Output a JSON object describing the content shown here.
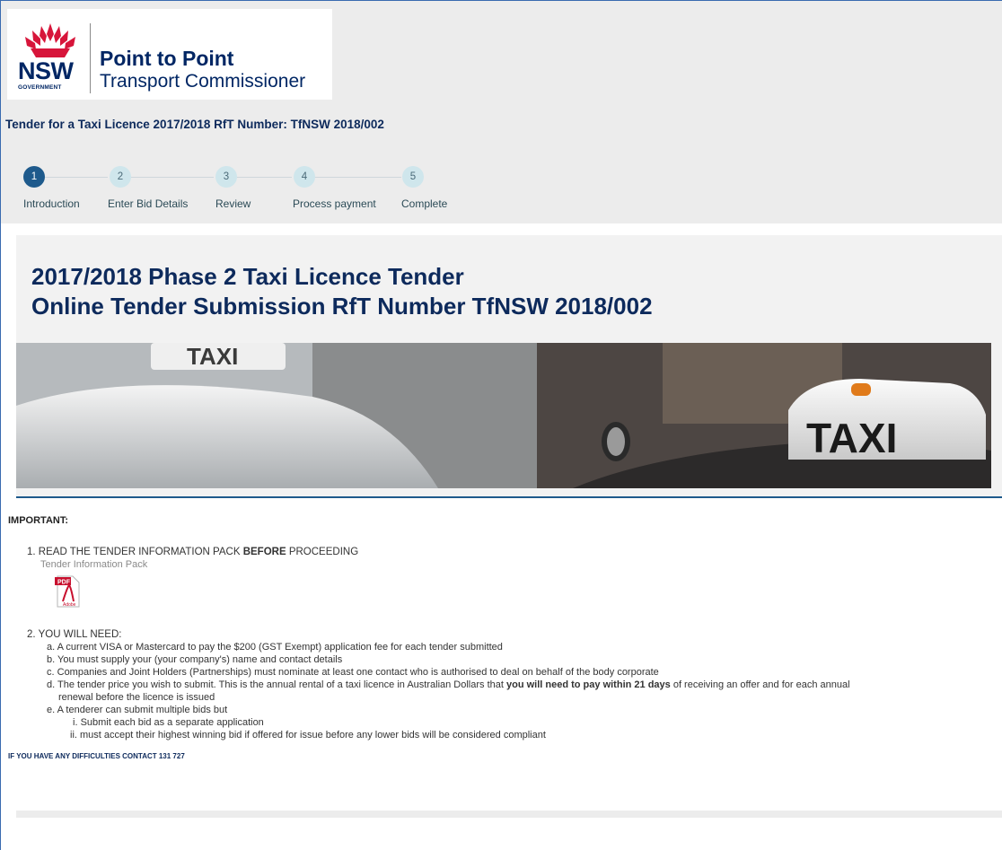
{
  "logo": {
    "nsw": "NSW",
    "government": "GOVERNMENT",
    "brand_line1": "Point to Point",
    "brand_line2": "Transport Commissioner",
    "brand_color": "#002664",
    "waratah_color": "#d7153a"
  },
  "tender_title": "Tender for a Taxi Licence 2017/2018 RfT Number: TfNSW 2018/002",
  "steps": [
    {
      "number": "1",
      "label": "Introduction",
      "active": true
    },
    {
      "number": "2",
      "label": "Enter Bid Details",
      "active": false
    },
    {
      "number": "3",
      "label": "Review",
      "active": false
    },
    {
      "number": "4",
      "label": "Process payment",
      "active": false
    },
    {
      "number": "5",
      "label": "Complete",
      "active": false
    }
  ],
  "heading_line1": "2017/2018 Phase 2 Taxi Licence Tender",
  "heading_line2": "Online Tender Submission RfT Number TfNSW 2018/002",
  "banner": {
    "sign_left": "TAXI",
    "sign_right": "TAXI"
  },
  "important_label": "IMPORTANT:",
  "item1": {
    "number": "1.",
    "text_before": "READ THE TENDER INFORMATION PACK ",
    "text_bold": "BEFORE",
    "text_after": " PROCEEDING",
    "pack_link": "Tender Information Pack",
    "pdf_label": "PDF",
    "adobe_label": "Adobe"
  },
  "item2": {
    "number": "2.",
    "heading": "YOU WILL NEED:",
    "sub": [
      {
        "marker": "a.",
        "text": "A current VISA or Mastercard to pay the $200 (GST Exempt) application fee for each tender submitted"
      },
      {
        "marker": "b.",
        "text": "You must supply your (your company's) name and contact details"
      },
      {
        "marker": "c.",
        "text": "Companies and Joint Holders (Partnerships) must nominate at least one contact who is authorised to deal on behalf of the body corporate"
      },
      {
        "marker": "e.",
        "text": "A tenderer can submit multiple bids but"
      }
    ],
    "d": {
      "marker": "d.",
      "before": "The tender price you wish to submit. This is the annual rental of a taxi licence in Australian Dollars that ",
      "bold": "you will need to pay within 21 days",
      "after": " of receiving an offer and for each annual",
      "line2": "renewal before the licence is issued"
    },
    "roman": [
      {
        "marker": "i.",
        "text": "Submit each bid as a separate application"
      },
      {
        "marker": "ii.",
        "text": "must accept their highest winning bid if offered for issue before any lower bids will be considered compliant"
      }
    ]
  },
  "contact_line": "IF YOU HAVE ANY DIFFICULTIES CONTACT   131 727"
}
